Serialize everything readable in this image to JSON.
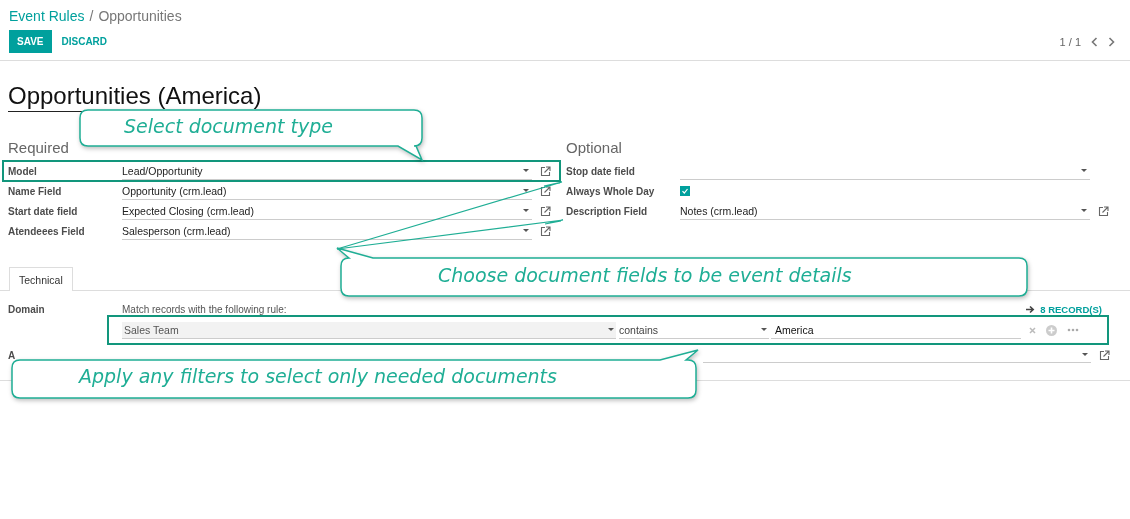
{
  "breadcrumb": {
    "separator": "/",
    "items": [
      {
        "label": "Event Rules",
        "kind": "link"
      },
      {
        "label": "Opportunities",
        "kind": "current"
      }
    ]
  },
  "buttons": [
    {
      "label": "SAVE",
      "kind": "primary"
    },
    {
      "label": "DISCARD",
      "kind": "link"
    }
  ],
  "pager": {
    "text": "1 / 1"
  },
  "title": "Opportunities (America)",
  "groups": [
    {
      "heading": "Required",
      "fields": [
        {
          "label": "Model",
          "kind": "select",
          "value": "Lead/Opportunity",
          "external_link": true,
          "highlighted": true
        },
        {
          "label": "Name Field",
          "kind": "select",
          "value": "Opportunity (crm.lead)",
          "external_link": true,
          "highlighted": false
        },
        {
          "label": "Start date field",
          "kind": "select",
          "value": "Expected Closing (crm.lead)",
          "external_link": true,
          "highlighted": false
        },
        {
          "label": "Atendeees Field",
          "kind": "select",
          "value": "Salesperson (crm.lead)",
          "external_link": true,
          "highlighted": false
        }
      ]
    },
    {
      "heading": "Optional",
      "fields": [
        {
          "label": "Stop date field",
          "kind": "select",
          "external_link": false,
          "highlighted": false
        },
        {
          "label": "Always Whole Day",
          "kind": "checkbox",
          "checked": true,
          "highlighted": false
        },
        {
          "label": "Description Field",
          "kind": "select",
          "value": "Notes (crm.lead)",
          "external_link": true,
          "highlighted": false
        }
      ]
    }
  ],
  "tabs": [
    {
      "label": "Technical",
      "selected": true
    }
  ],
  "domain": {
    "label": "Domain",
    "hint": "Match records with the following rule:",
    "record_count": "8 RECORD(S)",
    "rule": {
      "field": "Sales Team",
      "operator": "contains",
      "value": "America"
    }
  },
  "next_row": {
    "label": "A"
  },
  "callouts": [
    {
      "text": "Select document type"
    },
    {
      "text": "Choose document fields to be event details"
    },
    {
      "text": "Apply any filters to select only needed documents"
    }
  ]
}
